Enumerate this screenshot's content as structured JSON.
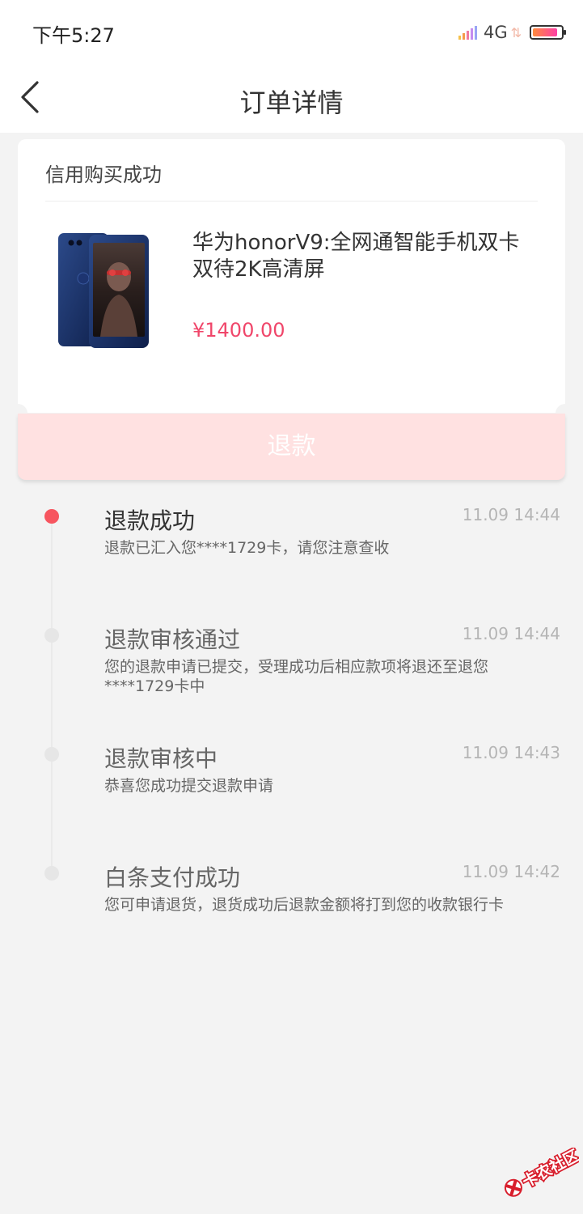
{
  "status_bar": {
    "time": "下午5:27",
    "network": "4G",
    "arrows": "⇅"
  },
  "header": {
    "title": "订单详情",
    "back_icon": "chevron-left-icon"
  },
  "order_card": {
    "status_title": "信用购买成功",
    "product_name": "华为honorV9:全网通智能手机双卡双待2K高清屏",
    "price": "¥1400.00"
  },
  "refund_button": {
    "label": "退款"
  },
  "timeline": [
    {
      "title": "退款成功",
      "time": "11.09 14:44",
      "desc": "退款已汇入您****1729卡，请您注意查收",
      "active": true
    },
    {
      "title": "退款审核通过",
      "time": "11.09 14:44",
      "desc": "您的退款申请已提交，受理成功后相应款项将退还至退您****1729卡中",
      "active": false
    },
    {
      "title": "退款审核中",
      "time": "11.09 14:43",
      "desc": "恭喜您成功提交退款申请",
      "active": false
    },
    {
      "title": "白条支付成功",
      "time": "11.09 14:42",
      "desc": "您可申请退货，退货成功后退款金额将打到您的收款银行卡",
      "active": false
    }
  ],
  "watermark": {
    "text": "卡农社区"
  },
  "colors": {
    "accent": "#f7555f",
    "price": "#f0466a",
    "refund_button_bg": "#ffe1e1",
    "background": "#f3f3f3"
  }
}
